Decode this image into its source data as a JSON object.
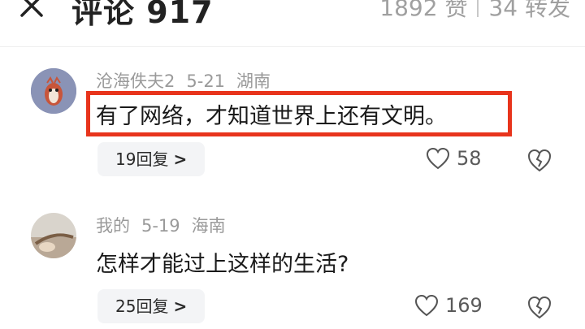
{
  "header": {
    "title": "评论 917",
    "likes": "1892 赞",
    "reposts": "34 转发"
  },
  "comments": [
    {
      "username": "沧海佚夫2",
      "date": "5-21",
      "location": "湖南",
      "text": "有了网络，才知道世界上还有文明。",
      "highlighted": true,
      "replies": "19回复",
      "like_count": "58"
    },
    {
      "username": "我的",
      "date": "5-19",
      "location": "海南",
      "text": "怎样才能过上这样的生活?",
      "highlighted": false,
      "replies": "25回复",
      "like_count": "169"
    }
  ],
  "colors": {
    "highlight_border": "#e8341c",
    "muted_text": "#9a9a9a",
    "pill_bg": "#f3f4f6"
  },
  "icons": {
    "close": "close-icon",
    "like": "heart-icon",
    "dislike": "broken-heart-icon",
    "chevron": "chevron-right-icon"
  }
}
